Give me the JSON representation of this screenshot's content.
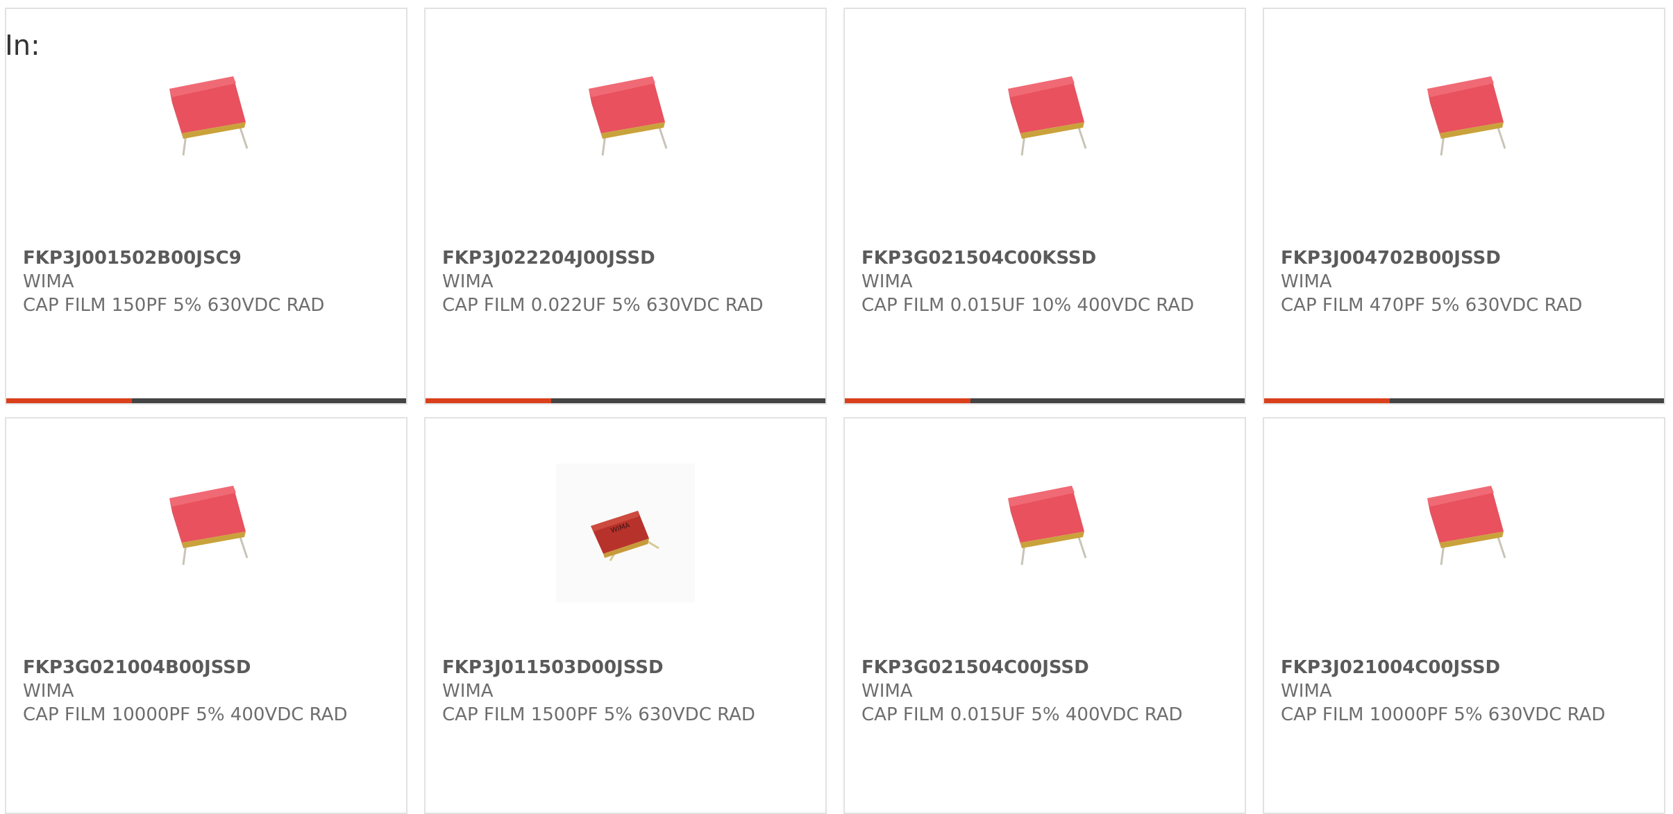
{
  "header": {
    "label": "In:"
  },
  "colors": {
    "accent": "#d9401b",
    "bar_track": "#444444",
    "card_border": "#e2e2e2",
    "text": "#6d6d6d"
  },
  "products": [
    {
      "part_number": "FKP3J001502B00JSC9",
      "manufacturer": "WIMA",
      "description": "CAP FILM 150PF 5% 630VDC RAD",
      "image_icon": "red-film-capacitor-icon",
      "progress": 0.315
    },
    {
      "part_number": "FKP3J022204J00JSSD",
      "manufacturer": "WIMA",
      "description": "CAP FILM 0.022UF 5% 630VDC RAD",
      "image_icon": "red-film-capacitor-icon",
      "progress": 0.315
    },
    {
      "part_number": "FKP3G021504C00KSSD",
      "manufacturer": "WIMA",
      "description": "CAP FILM 0.015UF 10% 400VDC RAD",
      "image_icon": "red-film-capacitor-icon",
      "progress": 0.315
    },
    {
      "part_number": "FKP3J004702B00JSSD",
      "manufacturer": "WIMA",
      "description": "CAP FILM 470PF 5% 630VDC RAD",
      "image_icon": "red-film-capacitor-icon",
      "progress": 0.315
    },
    {
      "part_number": "FKP3G021004B00JSSD",
      "manufacturer": "WIMA",
      "description": "CAP FILM 10000PF 5% 400VDC RAD",
      "image_icon": "red-film-capacitor-icon"
    },
    {
      "part_number": "FKP3J011503D00JSSD",
      "manufacturer": "WIMA",
      "description": "CAP FILM 1500PF 5% 630VDC RAD",
      "image_icon": "small-labeled-film-capacitor-icon"
    },
    {
      "part_number": "FKP3G021504C00JSSD",
      "manufacturer": "WIMA",
      "description": "CAP FILM 0.015UF 5% 400VDC RAD",
      "image_icon": "red-film-capacitor-icon"
    },
    {
      "part_number": "FKP3J021004C00JSSD",
      "manufacturer": "WIMA",
      "description": "CAP FILM 10000PF 5% 630VDC RAD",
      "image_icon": "red-film-capacitor-icon"
    }
  ]
}
